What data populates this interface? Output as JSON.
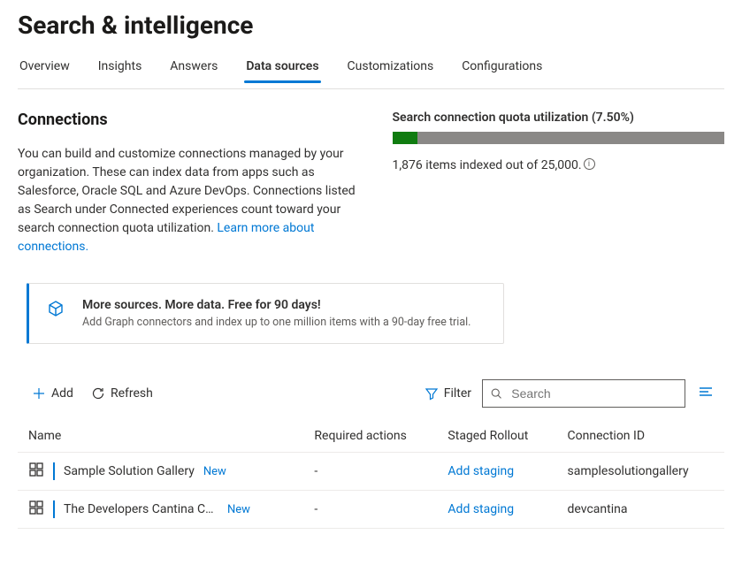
{
  "page": {
    "title": "Search & intelligence"
  },
  "tabs": [
    {
      "label": "Overview"
    },
    {
      "label": "Insights"
    },
    {
      "label": "Answers"
    },
    {
      "label": "Data sources"
    },
    {
      "label": "Customizations"
    },
    {
      "label": "Configurations"
    }
  ],
  "activeTab": 3,
  "connections": {
    "title": "Connections",
    "description": "You can build and customize connections managed by your organization. These can index data from apps such as Salesforce, Oracle SQL and Azure DevOps. Connections listed as Search under Connected experiences count toward your search connection quota utilization. ",
    "learnMore": "Learn more about connections."
  },
  "quota": {
    "title": "Search connection quota utilization (7.50%)",
    "percent": 7.5,
    "sub_pre": "1,876 items indexed out of 25,000.",
    "indexed": 1876,
    "total": 25000
  },
  "promo": {
    "title": "More sources. More data. Free for 90 days!",
    "sub": "Add Graph connectors and index up to one million items with a 90-day free trial."
  },
  "toolbar": {
    "add": "Add",
    "refresh": "Refresh",
    "filter": "Filter",
    "searchPlaceholder": "Search"
  },
  "table": {
    "columns": {
      "name": "Name",
      "required": "Required actions",
      "staged": "Staged Rollout",
      "connId": "Connection ID"
    },
    "rows": [
      {
        "name": "Sample Solution Gallery",
        "badge": "New",
        "required": "-",
        "staged": "Add staging",
        "connId": "samplesolutiongallery"
      },
      {
        "name": "The Developers Cantina Conn…",
        "badge": "New",
        "required": "-",
        "staged": "Add staging",
        "connId": "devcantina"
      }
    ]
  }
}
